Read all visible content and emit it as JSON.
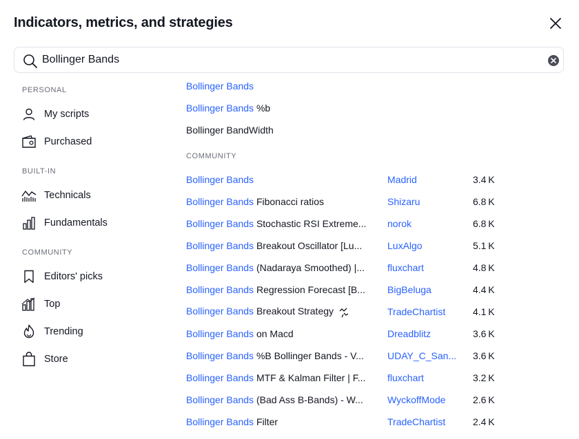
{
  "dialog": {
    "title": "Indicators, metrics, and strategies"
  },
  "search": {
    "value": "Bollinger Bands",
    "placeholder": "Search"
  },
  "sidebar": {
    "sections": [
      {
        "label": "PERSONAL"
      },
      {
        "label": "BUILT-IN"
      },
      {
        "label": "COMMUNITY"
      }
    ],
    "items": [
      {
        "label": "My scripts",
        "icon": "user-icon"
      },
      {
        "label": "Purchased",
        "icon": "wallet-icon"
      },
      {
        "label": "Technicals",
        "icon": "technicals-chart-icon"
      },
      {
        "label": "Fundamentals",
        "icon": "bar-chart-icon"
      },
      {
        "label": "Editors' picks",
        "icon": "bookmark-icon"
      },
      {
        "label": "Top",
        "icon": "top-bars-icon"
      },
      {
        "label": "Trending",
        "icon": "trending-flame-icon"
      },
      {
        "label": "Store",
        "icon": "shopping-bag-icon"
      }
    ]
  },
  "builtin_results": [
    {
      "highlight": "Bollinger Bands",
      "rest": ""
    },
    {
      "highlight": "Bollinger Bands",
      "rest": " %b"
    },
    {
      "highlight": "",
      "rest": "Bollinger BandWidth"
    }
  ],
  "community_label": "COMMUNITY",
  "community_results": [
    {
      "highlight": "Bollinger Bands",
      "rest": "",
      "author": "Madrid",
      "count": "3.4 K"
    },
    {
      "highlight": "Bollinger Bands",
      "rest": " Fibonacci ratios",
      "author": "Shizaru",
      "count": "6.8 K"
    },
    {
      "highlight": "Bollinger Bands",
      "rest": " Stochastic RSI Extreme...",
      "author": "norok",
      "count": "6.8 K"
    },
    {
      "highlight": "Bollinger Bands",
      "rest": " Breakout Oscillator [Lu...",
      "author": "LuxAlgo",
      "count": "5.1 K"
    },
    {
      "highlight": "Bollinger Bands",
      "rest": " (Nadaraya Smoothed) |...",
      "author": "fluxchart",
      "count": "4.8 K"
    },
    {
      "highlight": "Bollinger Bands",
      "rest": " Regression Forecast [B...",
      "author": "BigBeluga",
      "count": "4.4 K"
    },
    {
      "highlight": "Bollinger Bands",
      "rest": " Breakout Strategy",
      "author": "TradeChartist",
      "count": "4.1 K",
      "strategy_icon": "strategy-icon"
    },
    {
      "highlight": "Bollinger Bands",
      "rest": " on Macd",
      "author": "Dreadblitz",
      "count": "3.6 K"
    },
    {
      "highlight": "Bollinger Bands",
      "rest": " %B Bollinger Bands - V...",
      "author": "UDAY_C_San...",
      "count": "3.6 K"
    },
    {
      "highlight": "Bollinger Bands",
      "rest": " MTF & Kalman Filter | F...",
      "author": "fluxchart",
      "count": "3.2 K"
    },
    {
      "highlight": "Bollinger Bands",
      "rest": " (Bad Ass B-Bands) - W...",
      "author": "WyckoffMode",
      "count": "2.6 K"
    },
    {
      "highlight": "Bollinger Bands",
      "rest": " Filter",
      "author": "TradeChartist",
      "count": "2.4 K"
    }
  ],
  "colors": {
    "accent": "#2962ff",
    "text": "#131722",
    "muted": "#6a6d78",
    "border": "#e0e3eb"
  }
}
